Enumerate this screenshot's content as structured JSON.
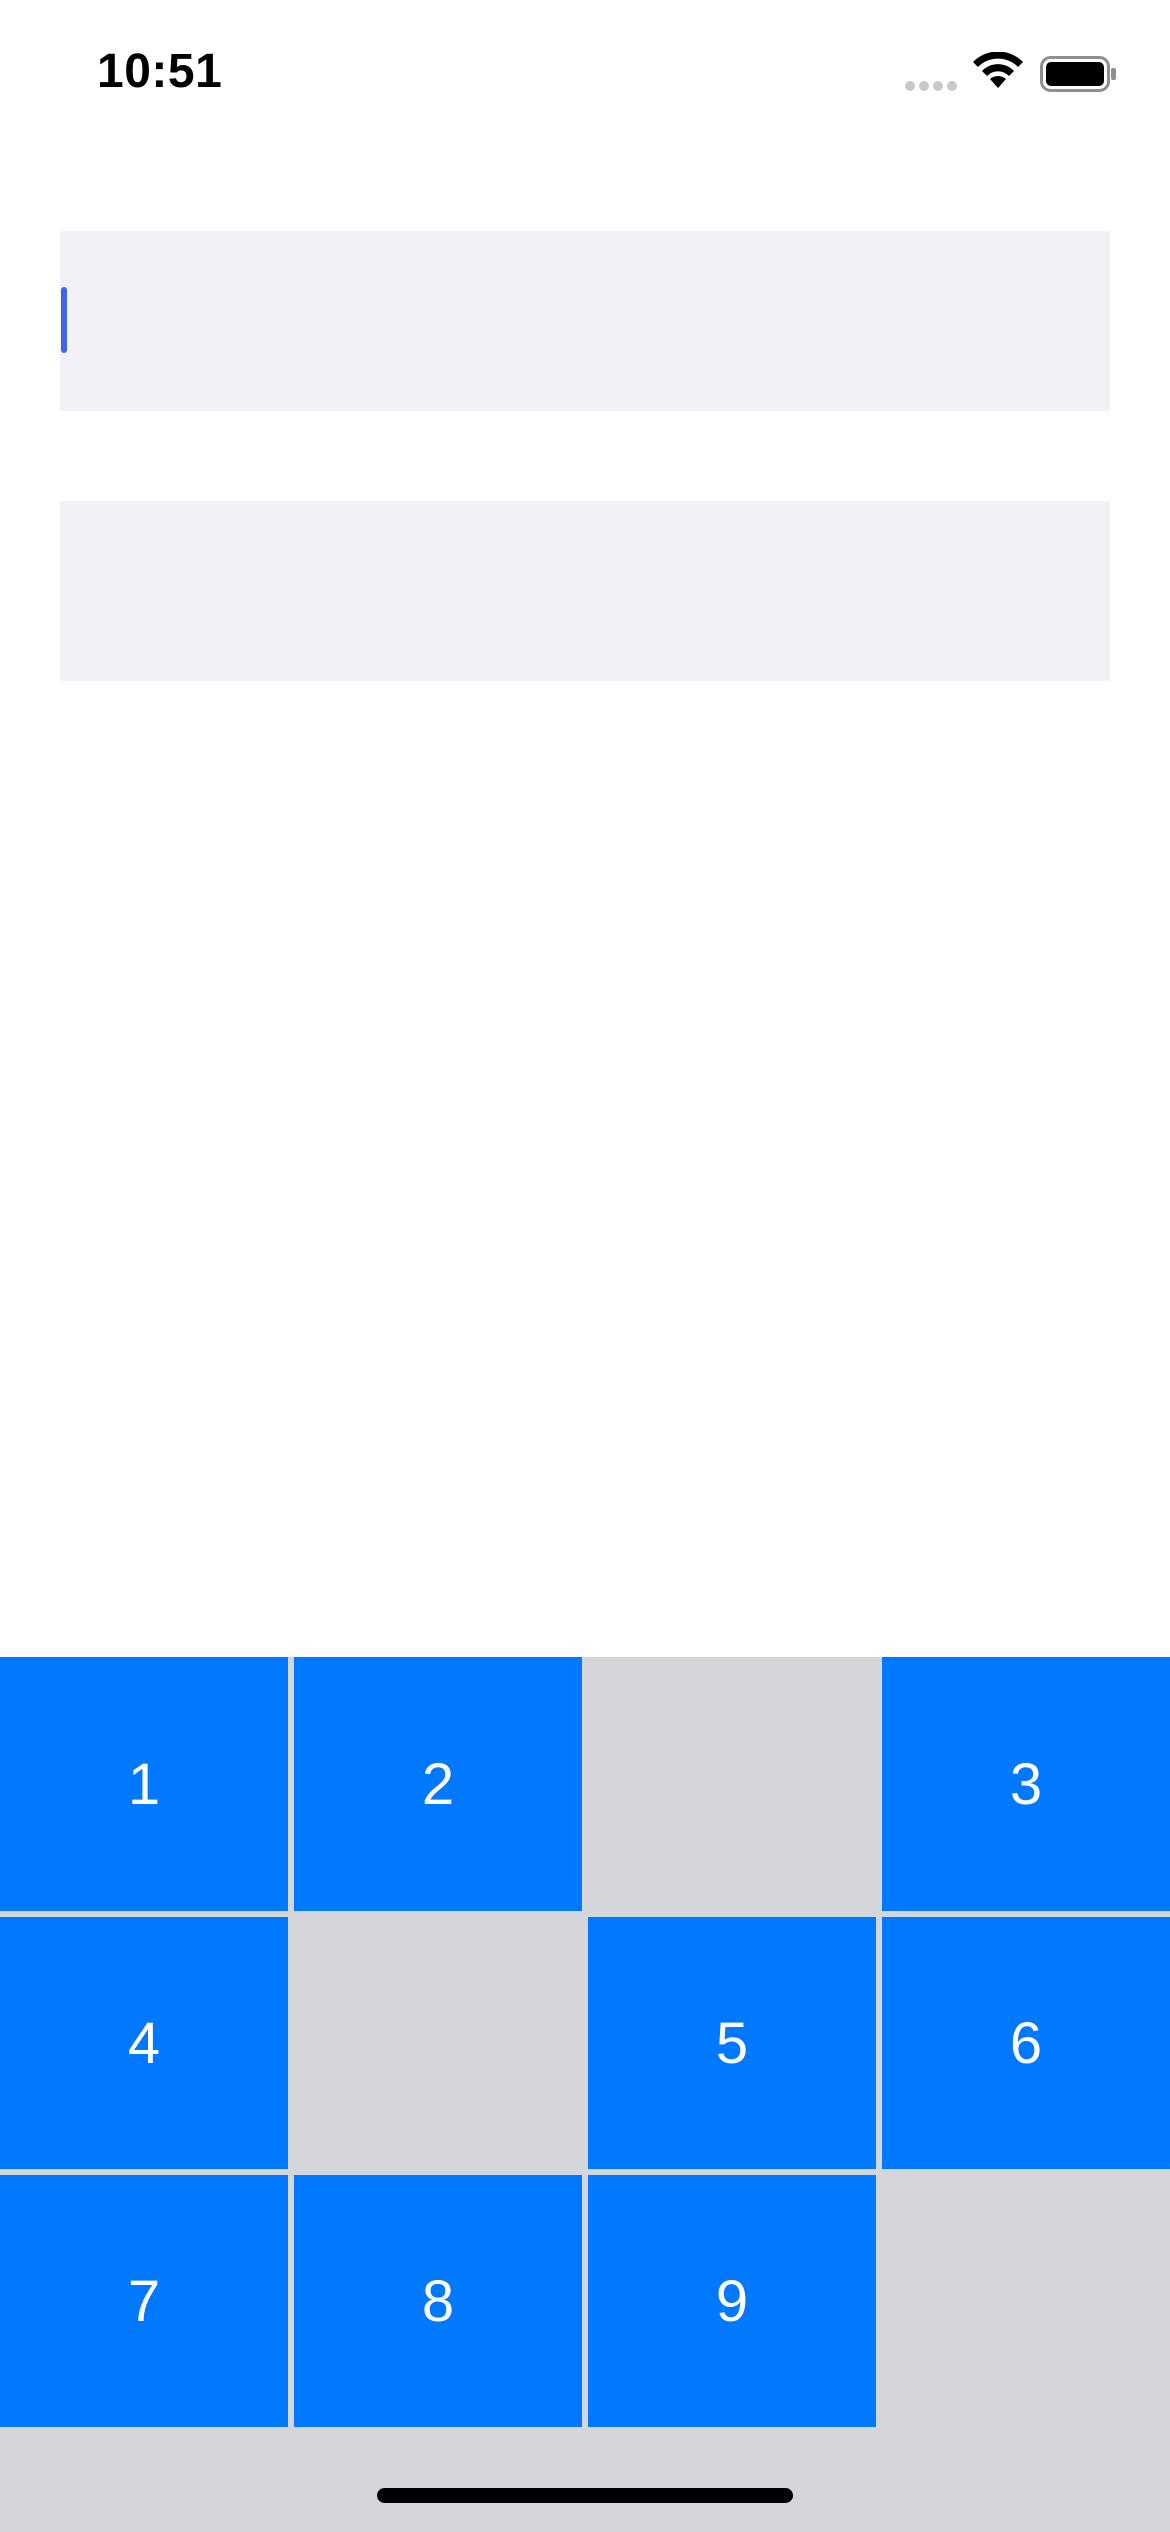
{
  "status_bar": {
    "time": "10:51",
    "icons": [
      "signal-icon",
      "wifi-icon",
      "battery-icon"
    ]
  },
  "fields": [
    {
      "value": "",
      "placeholder": "",
      "focused": true
    },
    {
      "value": "",
      "placeholder": "",
      "focused": false
    }
  ],
  "keypad": {
    "keys": [
      "1",
      "2",
      "3",
      "4",
      "5",
      "6",
      "7",
      "8",
      "9"
    ]
  },
  "colors": {
    "key_background": "#0079fe",
    "key_text": "#ffffff",
    "keypad_background": "#d5d6db",
    "field_background": "#f2f2f6",
    "caret": "#3d66e8"
  }
}
